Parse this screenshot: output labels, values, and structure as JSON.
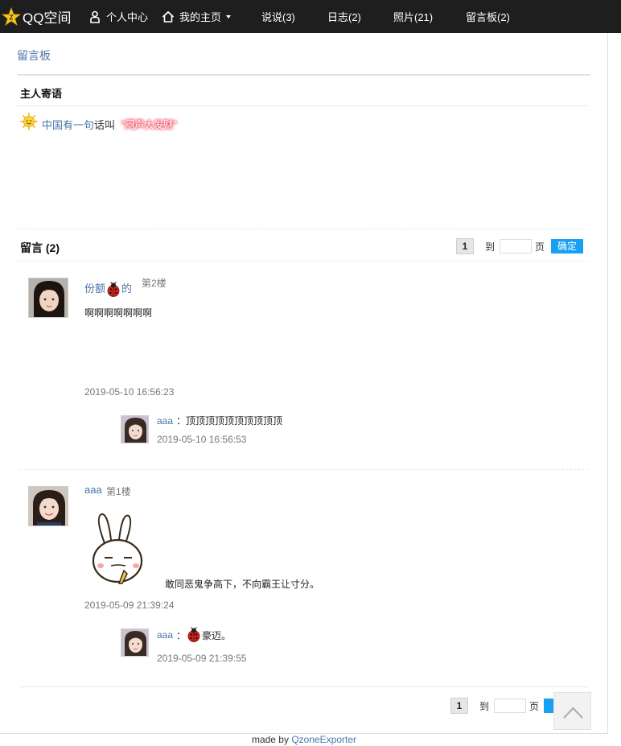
{
  "topbar": {
    "logo_text": "QQ空间",
    "nav": {
      "profile": "个人中心",
      "home": "我的主页",
      "shuoshuo": "说说(3)",
      "diary": "日志(2)",
      "photos": "照片(21)",
      "board": "留言板(2)"
    }
  },
  "breadcrumb": "留言板",
  "owner": {
    "title": "主人寄语",
    "text_blue": "中国有一句",
    "text_plain": "话叫",
    "glow_text": "\"闷声大发财\""
  },
  "messages_section": {
    "title": "留言 (2)",
    "pager": {
      "page": "1",
      "to": "到",
      "unit": "页",
      "confirm": "确定"
    }
  },
  "messages": [
    {
      "user_prefix": "份额",
      "user_suffix": "的",
      "floor": "第2楼",
      "content": "啊啊啊啊啊啊啊",
      "time": "2019-05-10 16:56:23",
      "reply": {
        "user": "aaa",
        "sep": "：",
        "text": "顶顶顶顶顶顶顶顶顶顶",
        "time": "2019-05-10 16:56:53"
      }
    },
    {
      "user": "aaa",
      "floor": "第1楼",
      "content": "敢同恶鬼争高下，不向霸王让寸分。",
      "time": "2019-05-09 21:39:24",
      "reply": {
        "user": "aaa",
        "sep": "：",
        "text": "豪迈。",
        "time": "2019-05-09 21:39:55"
      }
    }
  ],
  "bottom_pager": {
    "page": "1",
    "to": "到",
    "unit": "页"
  },
  "footer": {
    "prefix": "made by",
    "link": "QzoneExporter"
  },
  "colors": {
    "nav_bg": "#1e1e1e",
    "link": "#4a76a8",
    "button": "#18a0f5",
    "glow": "#e8253b"
  }
}
